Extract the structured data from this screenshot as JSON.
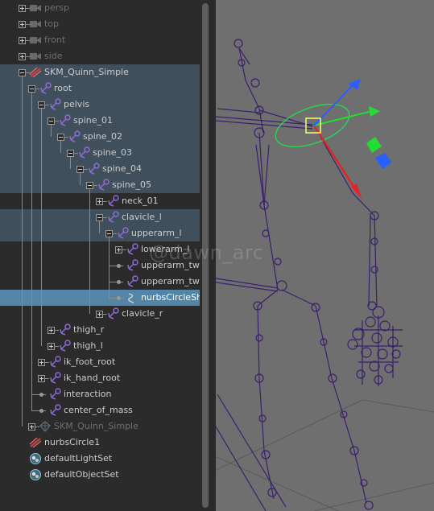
{
  "outliner": {
    "rows": [
      {
        "label": "persp",
        "depth": 1,
        "expander": "plus",
        "icon": "camera-icon",
        "dim": true
      },
      {
        "label": "top",
        "depth": 1,
        "expander": "plus",
        "icon": "camera-icon",
        "dim": true
      },
      {
        "label": "front",
        "depth": 1,
        "expander": "plus",
        "icon": "camera-icon",
        "dim": true
      },
      {
        "label": "side",
        "depth": 1,
        "expander": "plus",
        "icon": "camera-icon",
        "dim": true
      },
      {
        "label": "SKM_Quinn_Simple",
        "depth": 1,
        "expander": "minus",
        "icon": "transform-icon",
        "hl": true
      },
      {
        "label": "root",
        "depth": 2,
        "expander": "minus",
        "icon": "joint-icon",
        "hl": true
      },
      {
        "label": "pelvis",
        "depth": 3,
        "expander": "minus",
        "icon": "joint-icon",
        "hl": true
      },
      {
        "label": "spine_01",
        "depth": 4,
        "expander": "minus",
        "icon": "joint-icon",
        "hl": true
      },
      {
        "label": "spine_02",
        "depth": 5,
        "expander": "minus",
        "icon": "joint-icon",
        "hl": true
      },
      {
        "label": "spine_03",
        "depth": 6,
        "expander": "minus",
        "icon": "joint-icon",
        "hl": true
      },
      {
        "label": "spine_04",
        "depth": 7,
        "expander": "minus",
        "icon": "joint-icon",
        "hl": true
      },
      {
        "label": "spine_05",
        "depth": 8,
        "expander": "minus",
        "icon": "joint-icon",
        "hl": true
      },
      {
        "label": "neck_01",
        "depth": 9,
        "expander": "plus",
        "icon": "joint-icon"
      },
      {
        "label": "clavicle_l",
        "depth": 9,
        "expander": "minus",
        "icon": "joint-icon",
        "hl": true
      },
      {
        "label": "upperarm_l",
        "depth": 10,
        "expander": "minus",
        "icon": "joint-icon",
        "hl": true
      },
      {
        "label": "lowerarm_l",
        "depth": 11,
        "expander": "plus",
        "icon": "joint-icon"
      },
      {
        "label": "upperarm_twi",
        "depth": 11,
        "expander": "none",
        "icon": "joint-icon"
      },
      {
        "label": "upperarm_twi",
        "depth": 11,
        "expander": "none",
        "icon": "joint-icon"
      },
      {
        "label": "nurbsCircleSh",
        "depth": 11,
        "expander": "none",
        "icon": "curve-shape-icon",
        "sel": true
      },
      {
        "label": "clavicle_r",
        "depth": 9,
        "expander": "plus",
        "icon": "joint-icon"
      },
      {
        "label": "thigh_r",
        "depth": 4,
        "expander": "plus",
        "icon": "joint-icon"
      },
      {
        "label": "thigh_l",
        "depth": 4,
        "expander": "plus",
        "icon": "joint-icon"
      },
      {
        "label": "ik_foot_root",
        "depth": 3,
        "expander": "plus",
        "icon": "joint-icon"
      },
      {
        "label": "ik_hand_root",
        "depth": 3,
        "expander": "plus",
        "icon": "joint-icon"
      },
      {
        "label": "interaction",
        "depth": 3,
        "expander": "none",
        "icon": "joint-icon"
      },
      {
        "label": "center_of_mass",
        "depth": 3,
        "expander": "none",
        "icon": "joint-icon"
      },
      {
        "label": "SKM_Quinn_Simple",
        "depth": 2,
        "expander": "plus",
        "icon": "mesh-icon",
        "dim": true
      },
      {
        "label": "nurbsCircle1",
        "depth": 1,
        "expander": "none",
        "icon": "transform-icon"
      },
      {
        "label": "defaultLightSet",
        "depth": 1,
        "expander": "none",
        "icon": "set-icon"
      },
      {
        "label": "defaultObjectSet",
        "depth": 1,
        "expander": "none",
        "icon": "set-icon"
      }
    ]
  },
  "watermark": "@dawn_arc",
  "colors": {
    "selection": "#5285a6",
    "hierarchy_highlight": "#3f4f5b",
    "joint": "#3a1f6e",
    "nurbs_circle": "#22dd55",
    "manip_x": "#e0252a",
    "manip_y": "#22dd33",
    "manip_z": "#2a5fff"
  }
}
